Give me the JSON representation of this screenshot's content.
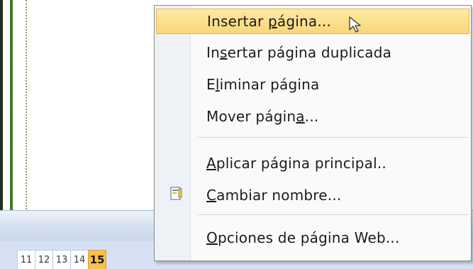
{
  "tabs": [
    "11",
    "12",
    "13",
    "14",
    "15"
  ],
  "active_tab": "15",
  "context_menu": {
    "items": [
      {
        "pre": "Insertar ",
        "ul": "p",
        "post": "ágina..."
      },
      {
        "pre": "In",
        "ul": "s",
        "post": "ertar página duplicada"
      },
      {
        "pre": "E",
        "ul": "l",
        "post": "iminar página"
      },
      {
        "pre": "Mover págin",
        "ul": "a",
        "post": "..."
      },
      {
        "pre": "",
        "ul": "A",
        "post": "plicar página principal.."
      },
      {
        "pre": "",
        "ul": "C",
        "post": "ambiar nombre..."
      },
      {
        "pre": "",
        "ul": "O",
        "post": "pciones de página Web..."
      }
    ],
    "highlighted_index": 0
  },
  "icons": {
    "rename": "rename-page-icon",
    "cursor": "mouse-pointer-icon"
  },
  "colors": {
    "highlight": "#f8d777",
    "active_tab": "#f6c04a",
    "guide_green": "#4a7a2a"
  }
}
